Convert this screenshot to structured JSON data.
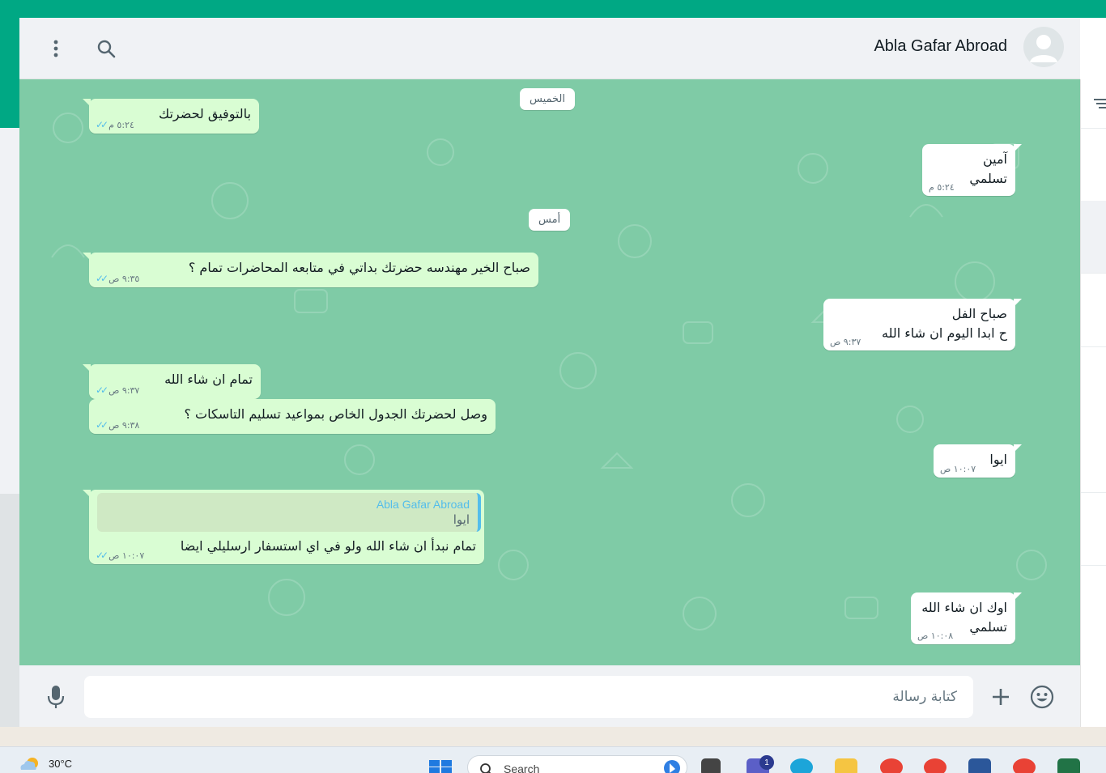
{
  "header": {
    "contact_name": "Abla Gafar Abroad",
    "icons": [
      "avatar-icon",
      "search-icon",
      "menu-dots-icon"
    ]
  },
  "dates": {
    "thursday": "الخميس",
    "yesterday": "أمس"
  },
  "messages": [
    {
      "dir": "in",
      "lines": [
        "بالتوفيق لحضرتك"
      ],
      "time": "٥:٢٤ م",
      "status": "read"
    },
    {
      "dir": "out",
      "lines": [
        "آمين",
        "تسلمي"
      ],
      "time": "٥:٢٤ م"
    },
    {
      "dir": "in",
      "lines": [
        "صباح الخير مهندسه حضرتك بداتي في متابعه المحاضرات تمام ؟"
      ],
      "time": "٩:٣٥ ص",
      "status": "read"
    },
    {
      "dir": "out",
      "lines": [
        "صباح الفل",
        "ح ابدا اليوم ان شاء الله"
      ],
      "time": "٩:٣٧ ص"
    },
    {
      "dir": "in",
      "lines": [
        "تمام ان شاء الله"
      ],
      "time": "٩:٣٧ ص",
      "status": "read"
    },
    {
      "dir": "in",
      "lines": [
        "وصل لحضرتك الجدول الخاص بمواعيد تسليم التاسكات ؟"
      ],
      "time": "٩:٣٨ ص",
      "status": "read"
    },
    {
      "dir": "out",
      "lines": [
        "ايوا"
      ],
      "time": "١٠:٠٧ ص"
    },
    {
      "dir": "in",
      "quote_author": "Abla Gafar Abroad",
      "quote_text": "ايوا",
      "lines": [
        "تمام نبدأ ان شاء الله ولو في اي استسفار ارسليلي ايضا"
      ],
      "time": "١٠:٠٧ ص",
      "status": "read"
    },
    {
      "dir": "out",
      "lines": [
        "اوك ان شاء الله",
        "تسلمي"
      ],
      "time": "١٠:٠٨ ص"
    }
  ],
  "composer": {
    "placeholder": "كتابة رسالة",
    "icons": [
      "emoji-icon",
      "plus-icon",
      "microphone-icon"
    ]
  },
  "taskbar": {
    "temperature": "30°C",
    "search_label": "Search",
    "teams_badge": "1"
  },
  "colors": {
    "brand": "#00a884",
    "chat_bg": "#7fcba6",
    "incoming_bubble": "#d9fdd3",
    "outgoing_bubble": "#ffffff",
    "read_tick": "#53bdeb"
  }
}
